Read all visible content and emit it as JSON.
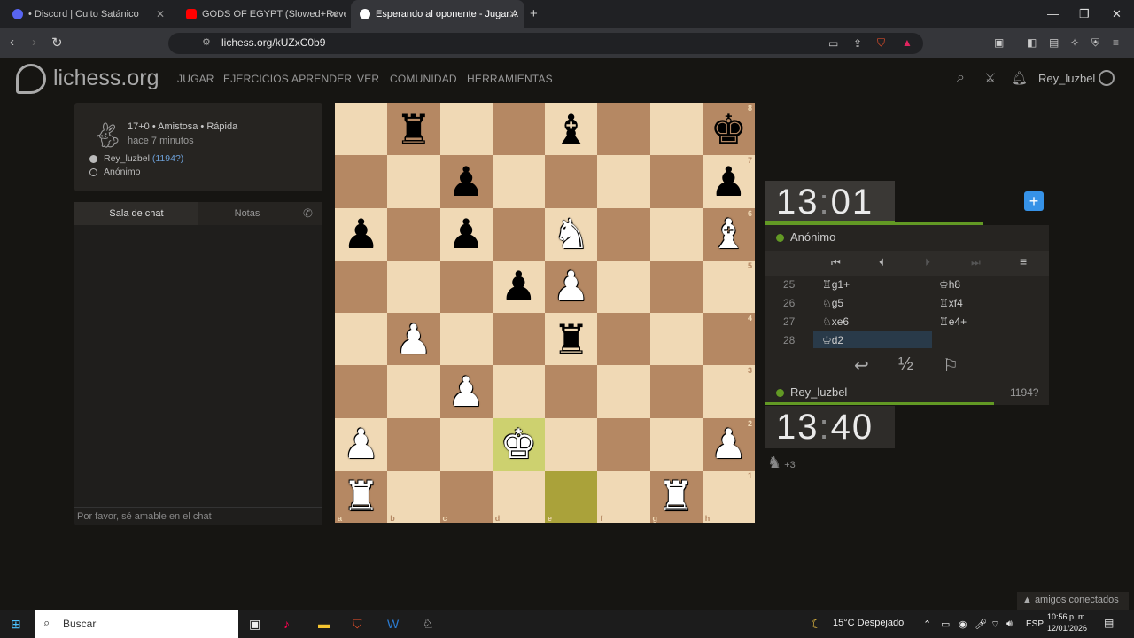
{
  "browser": {
    "tabs": [
      {
        "label": "• Discord | Culto Satánico",
        "color": "#5865f2"
      },
      {
        "label": "GODS OF EGYPT (Slowed+Reverb) - Y",
        "color": "#ff0000"
      },
      {
        "label": "Esperando al oponente - Jugar A",
        "color": "#ffffff"
      }
    ],
    "url": "lichess.org/kUZxC0b9",
    "new_tab": "+",
    "win_min": "—",
    "win_max": "❐",
    "win_close": "✕"
  },
  "site": {
    "brand": "lichess.org",
    "nav": [
      "JUGAR",
      "EJERCICIOS",
      "APRENDER",
      "VER",
      "COMUNIDAD",
      "HERRAMIENTAS"
    ],
    "username": "Rey_luzbel"
  },
  "game_info": {
    "mode": "17+0 • Amistosa • Rápida",
    "time_ago": "hace 7 minutos",
    "white_player": "Rey_luzbel",
    "white_rating": "(1194?)",
    "black_player": "Anónimo"
  },
  "chat": {
    "tab_chat": "Sala de chat",
    "tab_notes": "Notas",
    "placeholder": "Por favor, sé amable en el chat"
  },
  "board": {
    "ranks": [
      "8",
      "7",
      "6",
      "5",
      "4",
      "3",
      "2",
      "1"
    ],
    "files": [
      "a",
      "b",
      "c",
      "d",
      "e",
      "f",
      "g",
      "h"
    ],
    "position": [
      [
        "",
        "br",
        "",
        "",
        "bb",
        "",
        "",
        "bk"
      ],
      [
        "",
        "",
        "bp",
        "",
        "",
        "",
        "",
        "bp"
      ],
      [
        "bp",
        "",
        "bp",
        "",
        "wn",
        "",
        "",
        "wb"
      ],
      [
        "",
        "",
        "",
        "bp",
        "wp",
        "",
        "",
        ""
      ],
      [
        "",
        "wp",
        "",
        "",
        "br",
        "",
        "",
        ""
      ],
      [
        "",
        "",
        "wp",
        "",
        "",
        "",
        "",
        ""
      ],
      [
        "wp",
        "",
        "",
        "wk",
        "",
        "",
        "",
        "wp"
      ],
      [
        "wr",
        "",
        "",
        "",
        "",
        "",
        "wr",
        ""
      ]
    ],
    "last_move": [
      "d2",
      "e1"
    ]
  },
  "clocks": {
    "top_min": "13",
    "top_sec": "01",
    "bottom_min": "13",
    "bottom_sec": "40",
    "sep": ":"
  },
  "moves": {
    "opponent": "Anónimo",
    "me": "Rey_luzbel",
    "my_rating": "1194?",
    "rows": [
      {
        "n": "25",
        "w": "♖g1+",
        "b": "♔h8"
      },
      {
        "n": "26",
        "w": "♘g5",
        "b": "♖xf4"
      },
      {
        "n": "27",
        "w": "♘xe6",
        "b": "♖e4+"
      },
      {
        "n": "28",
        "w": "♔d2",
        "b": ""
      }
    ],
    "draw": "½",
    "material": "+3"
  },
  "friends": "▲ amigos conectados",
  "taskbar": {
    "search": "Buscar",
    "weather": "15°C  Despejado",
    "lang": "ESP",
    "time": "10:56 p. m.",
    "date": "12/01/2026"
  },
  "colors": {
    "accent": "#629924",
    "highlight": "#aaa23a"
  }
}
